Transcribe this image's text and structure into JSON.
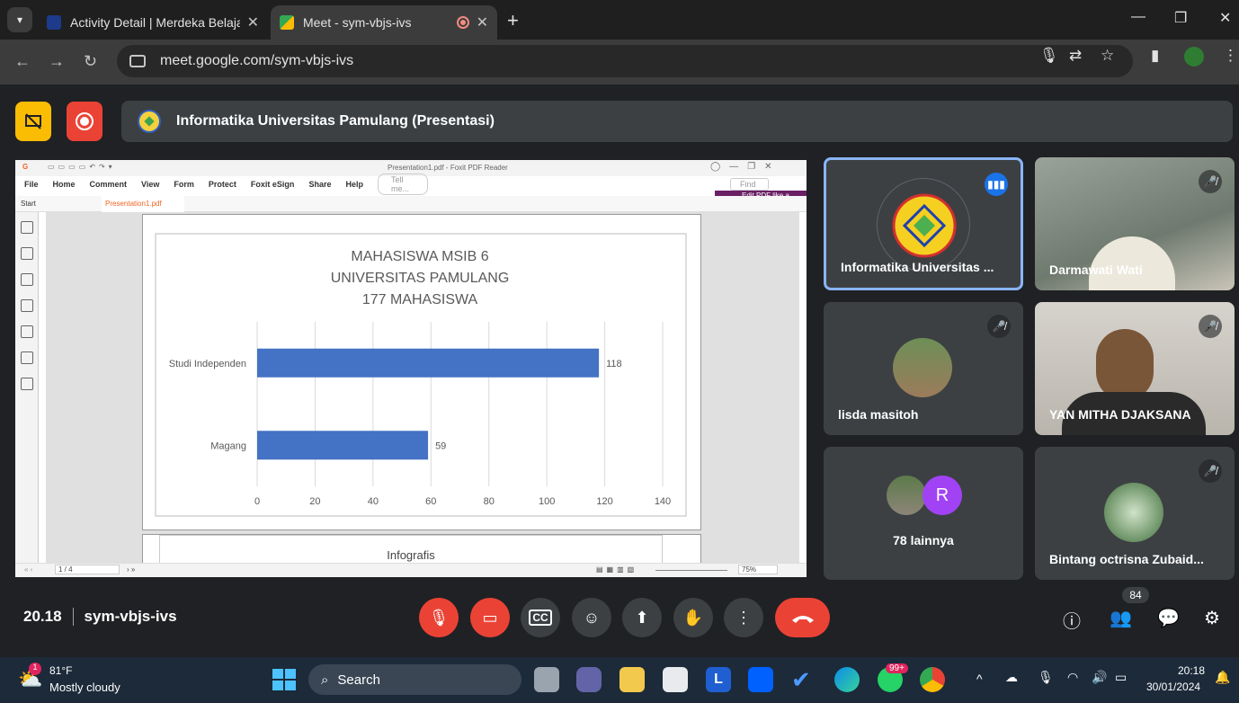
{
  "browser": {
    "tabs": [
      {
        "title": "Activity Detail | Merdeka Belajar",
        "active": false
      },
      {
        "title": "Meet - sym-vbjs-ivs",
        "active": true
      }
    ],
    "url": "meet.google.com/sym-vbjs-ivs",
    "new_tab_symbol": "+",
    "close_symbol": "✕"
  },
  "meet": {
    "presentation_title": "Informatika Universitas Pamulang (Presentasi)",
    "time": "20.18",
    "meeting_code": "sym-vbjs-ivs",
    "participants_count": "84",
    "colors": {
      "accent_blue": "#8ab4f8",
      "red": "#ea4335",
      "yellow": "#fbbc04"
    }
  },
  "foxit": {
    "window_title": "Presentation1.pdf - Foxit PDF Reader",
    "menu": [
      "File",
      "Home",
      "Comment",
      "View",
      "Form",
      "Protect",
      "Foxit eSign",
      "Share",
      "Help"
    ],
    "tell_me": "Tell me...",
    "find": "Find",
    "tabs": [
      "Start",
      "Presentation1.pdf"
    ],
    "edit_pdf_promo": "Edit PDF like a word processor",
    "page_indicator": "1 / 4",
    "zoom": "75%",
    "next_page_heading": "Infografis"
  },
  "chart_data": {
    "type": "bar",
    "orientation": "horizontal",
    "title": [
      "MAHASISWA MSIB 6",
      "UNIVERSITAS PAMULANG",
      "177 MAHASISWA"
    ],
    "categories": [
      "Studi Independen",
      "Magang"
    ],
    "values": [
      118,
      59
    ],
    "data_labels": [
      "118",
      "59"
    ],
    "xlim": [
      0,
      140
    ],
    "xticks": [
      "0",
      "20",
      "40",
      "60",
      "80",
      "100",
      "120",
      "140"
    ],
    "bar_color": "#4472c4",
    "grid": true
  },
  "participants": [
    {
      "name": "Informatika Universitas ...",
      "speaking": true
    },
    {
      "name": "Darmawati Wati",
      "muted": true
    },
    {
      "name": "lisda masitoh",
      "muted": true
    },
    {
      "name": "YAN MITHA DJAKSANA",
      "muted": true
    },
    {
      "name": "78 lainnya",
      "avatar_letter": "R"
    },
    {
      "name": "Bintang octrisna Zubaid...",
      "muted": true
    }
  ],
  "taskbar": {
    "weather_temp": "81°F",
    "weather_desc": "Mostly cloudy",
    "weather_badge": "1",
    "search_label": "Search",
    "whatsapp_badge": "99+",
    "clock_time": "20:18",
    "clock_date": "30/01/2024"
  }
}
